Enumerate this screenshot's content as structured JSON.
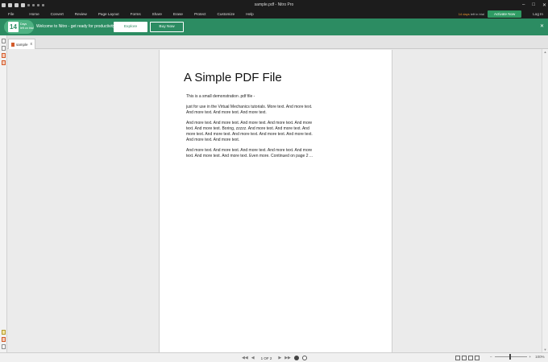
{
  "window": {
    "title": "sample.pdf - Nitro Pro"
  },
  "menu": {
    "items": [
      "File",
      "Home",
      "Convert",
      "Review",
      "Page Layout",
      "Forms",
      "Share",
      "Erase",
      "Protect",
      "Customize",
      "Help"
    ],
    "trial_days": "14 days",
    "trial_suffix": "left in trial",
    "activate_label": "Activate Now",
    "login_label": "Log In"
  },
  "promo": {
    "days_number": "14",
    "days_label": "Days",
    "days_sub": "left on trial",
    "message": "Welcome to Nitro - get ready for productivity!",
    "explore_label": "Explore",
    "buy_label": "Buy Now",
    "close_icon": "close-icon"
  },
  "tabs": [
    {
      "label": "sample",
      "close": "x"
    }
  ],
  "document": {
    "title": "A Simple PDF File",
    "paragraphs": [
      "This is a small demonstration .pdf file -",
      "just for use in the Virtual Mechanics tutorials. More text. And more text. And more text. And more text. And more text.",
      "And more text. And more text. And more text. And more text. And more text. And more text. Boring, zzzzz. And more text. And more text. And more text. And more text. And more text. And more text. And more text. And more text. And more text.",
      "And more text. And more text. And more text. And more text. And more text. And more text. And more text. Even more. Continued on page 2 ..."
    ]
  },
  "status": {
    "page_indicator": "1 OF 2",
    "zoom": "100%"
  },
  "colors": {
    "accent": "#2c8c62",
    "titlebar": "#1c1c1c",
    "trial_orange": "#f09a30"
  }
}
